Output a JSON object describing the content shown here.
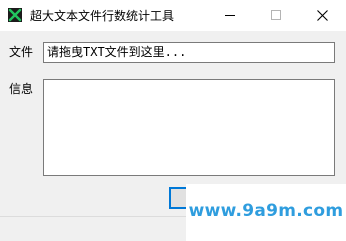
{
  "window": {
    "title": "超大文本文件行数统计工具"
  },
  "title_icons": {
    "app": "app-x-icon",
    "minimize": "minimize-icon",
    "maximize": "maximize-icon",
    "close": "close-icon"
  },
  "form": {
    "file_label": "文件",
    "file_value": "请拖曳TXT文件到这里...",
    "info_label": "信息",
    "info_value": ""
  },
  "watermark": {
    "text": "www.9a9m.com"
  },
  "colors": {
    "titlebar": "#ffffff",
    "window": "#f0f0f0",
    "focus_accent": "#0078d7",
    "watermark": "#2f9dde"
  }
}
